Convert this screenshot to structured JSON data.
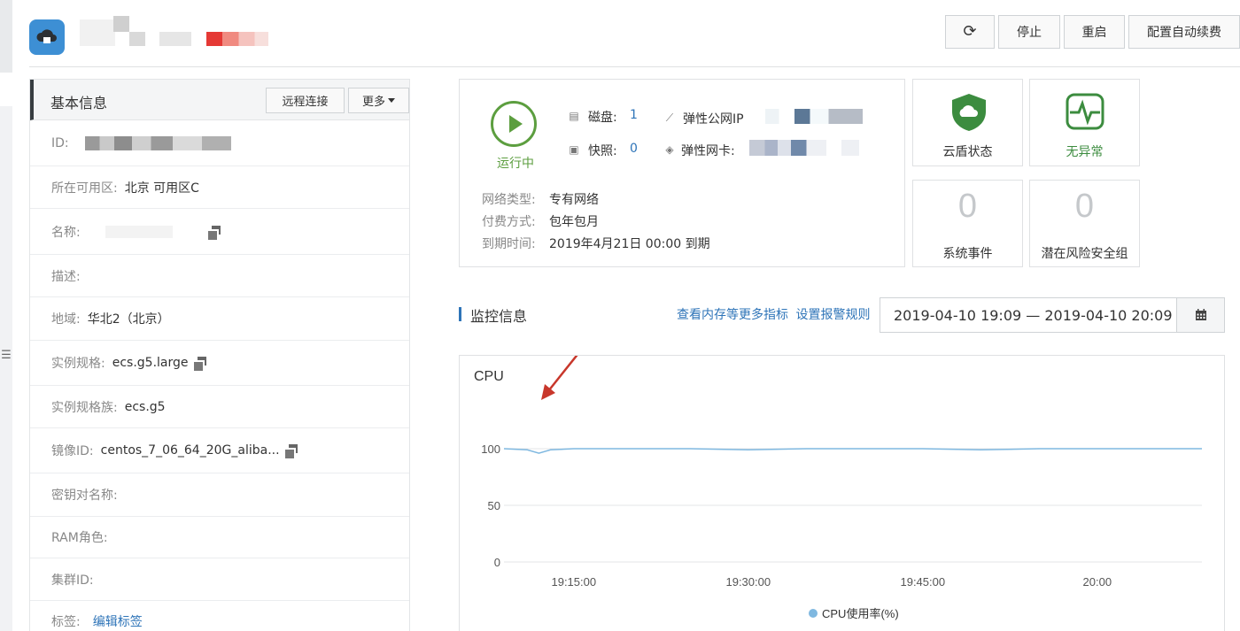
{
  "header": {
    "buttons": {
      "refresh_icon": "refresh-icon",
      "stop": "停止",
      "restart": "重启",
      "auto_renew": "配置自动续费"
    },
    "logo_icon": "cloud-server-icon"
  },
  "left_rail": {
    "handle_icon": "menu-collapse-icon"
  },
  "basic_info": {
    "title": "基本信息",
    "remote_connect": "远程连接",
    "more": "更多",
    "rows": [
      {
        "label": "ID:",
        "value": ""
      },
      {
        "label": "所在可用区:",
        "value": "北京 可用区C"
      },
      {
        "label": "名称:",
        "value": ""
      },
      {
        "label": "描述:",
        "value": ""
      },
      {
        "label": "地域:",
        "value": "华北2（北京）"
      },
      {
        "label": "实例规格:",
        "value": "ecs.g5.large"
      },
      {
        "label": "实例规格族:",
        "value": "ecs.g5"
      },
      {
        "label": "镜像ID:",
        "value": "centos_7_06_64_20G_aliba..."
      },
      {
        "label": "密钥对名称:",
        "value": ""
      },
      {
        "label": "RAM角色:",
        "value": ""
      },
      {
        "label": "集群ID:",
        "value": ""
      },
      {
        "label": "标签:",
        "value": "编辑标签"
      }
    ]
  },
  "status": {
    "state": "运行中",
    "disk_label": "磁盘:",
    "disk_count": "1",
    "snapshot_label": "快照:",
    "snapshot_count": "0",
    "eip_label": "弹性公网IP",
    "eni_label": "弹性网卡:",
    "network_type_label": "网络类型:",
    "network_type": "专有网络",
    "billing_label": "付费方式:",
    "billing": "包年包月",
    "expiry_label": "到期时间:",
    "expiry": "2019年4月21日 00:00 到期"
  },
  "tiles": {
    "cloud_shield": "云盾状态",
    "no_anomaly": "无异常",
    "system_events_count": "0",
    "system_events": "系统事件",
    "risk_groups_count": "0",
    "risk_groups": "潜在风险安全组"
  },
  "monitoring": {
    "title": "监控信息",
    "link_more": "查看内存等更多指标",
    "link_alarm": "设置报警规则",
    "date_range": "2019-04-10 19:09  —  2019-04-10 20:09"
  },
  "colors": {
    "accent": "#2e74b8",
    "running": "#5c9e3f",
    "series": "#7fb8e0",
    "annotation_arrow": "#c8372b"
  },
  "chart_data": {
    "type": "line",
    "title": "CPU",
    "x_ticks": [
      "19:15:00",
      "19:30:00",
      "19:45:00",
      "20:00"
    ],
    "y_ticks": [
      "100",
      "50",
      "0"
    ],
    "ylim": [
      0,
      100
    ],
    "grid": true,
    "legend": "bottom",
    "series": [
      {
        "name": "CPU使用率(%)",
        "x": [
          "19:09",
          "19:11",
          "19:12",
          "19:13",
          "19:15",
          "19:20",
          "19:25",
          "19:30",
          "19:35",
          "19:40",
          "19:45",
          "19:50",
          "19:55",
          "20:00",
          "20:05",
          "20:09"
        ],
        "values": [
          100,
          99,
          96,
          99,
          100,
          100,
          100,
          99,
          100,
          100,
          100,
          99,
          100,
          100,
          100,
          100
        ]
      }
    ]
  }
}
